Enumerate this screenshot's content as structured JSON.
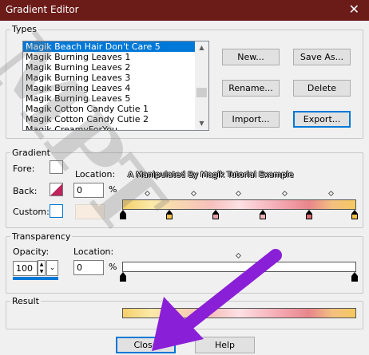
{
  "window": {
    "title": "Gradient Editor",
    "close_glyph": "✕"
  },
  "types": {
    "group_label": "Types",
    "items": [
      "Magik Beach Hair Don't Care 5",
      "Magik Burning Leaves 1",
      "Magik Burning Leaves 2",
      "Magik Burning Leaves 3",
      "Magik Burning Leaves 4",
      "Magik Burning Leaves 5",
      "Magik Cotton Candy Cutie 1",
      "Magik Cotton Candy Cutie 2",
      "Magik CreamyForYou..."
    ],
    "selected_index": 0,
    "buttons": {
      "new": "New...",
      "save_as": "Save As...",
      "rename": "Rename...",
      "delete": "Delete",
      "import": "Import...",
      "export": "Export..."
    }
  },
  "gradient": {
    "group_label": "Gradient",
    "fore_label": "Fore:",
    "back_label": "Back:",
    "custom_label": "Custom:",
    "location_label": "Location:",
    "location_value": "0",
    "percent": "%",
    "stop_colors": [
      "#f2c24a",
      "#e08a8a",
      "#f0b3b8",
      "#d86c74",
      "#f2c24a"
    ]
  },
  "transparency": {
    "group_label": "Transparency",
    "opacity_label": "Opacity:",
    "opacity_value": "100",
    "location_label": "Location:",
    "location_value": "0",
    "percent": "%"
  },
  "result": {
    "group_label": "Result"
  },
  "footer": {
    "close": "Close",
    "help": "Help"
  },
  "watermark": {
    "big": "MPT",
    "small": "A Manipulated By Magik Tutorial Example"
  },
  "colors": {
    "titlebar": "#6b1b18",
    "selection": "#0078d7",
    "arrow": "#8a1fd8"
  }
}
